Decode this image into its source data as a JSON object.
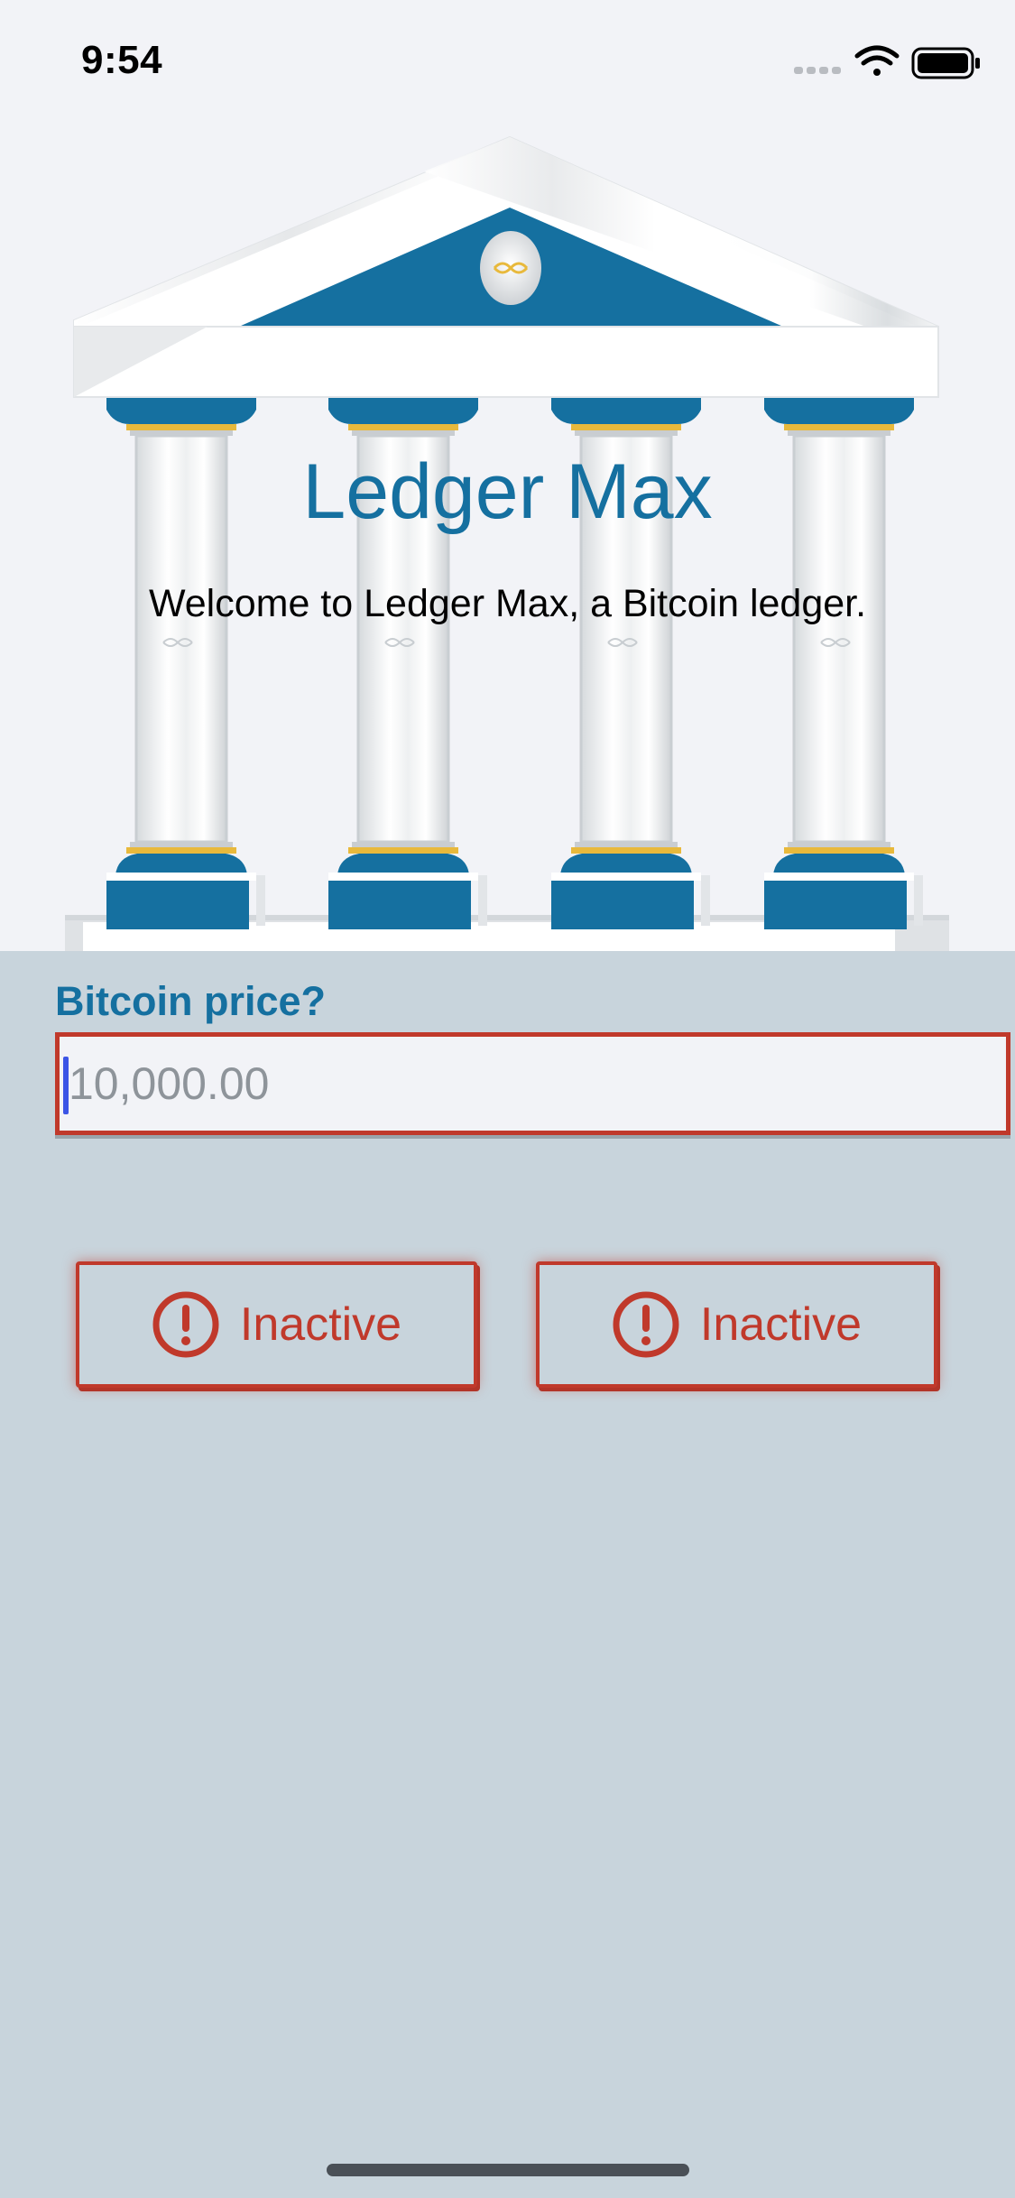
{
  "status_bar": {
    "time": "9:54",
    "icons": [
      "cellular-signal-icon",
      "wifi-icon",
      "battery-icon"
    ]
  },
  "hero": {
    "title": "Ledger Max",
    "subtitle": "Welcome to Ledger Max, a Bitcoin ledger.",
    "image": "greek-temple-bank-illustration"
  },
  "form": {
    "label": "Bitcoin price?",
    "input_value": "",
    "input_placeholder": "10,000.00"
  },
  "buttons": [
    {
      "label": "Inactive",
      "icon": "exclamation-circle-icon"
    },
    {
      "label": "Inactive",
      "icon": "exclamation-circle-icon"
    }
  ],
  "colors": {
    "brand_blue": "#1570a0",
    "error_red": "#c0392b",
    "hero_background": "#f2f3f7",
    "page_background": "#c8d4dc",
    "column_gold": "#e8b93c"
  }
}
